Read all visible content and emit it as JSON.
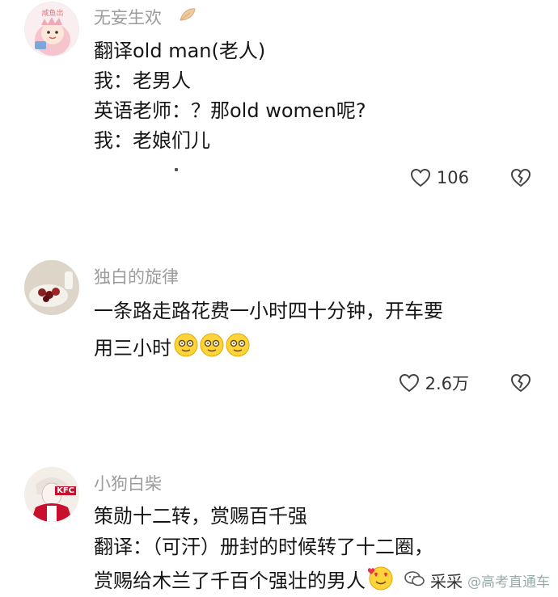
{
  "comments": [
    {
      "username": "无妄生欢",
      "avatar_icon": "pink-dinosaur-hoodie-avatar",
      "avatar_text": "咸鱼出",
      "lines": [
        "翻译old man(老人)",
        "我：老男人",
        "英语老师：？那old women呢?",
        "我：老娘们儿"
      ],
      "likes": "106"
    },
    {
      "username": "独白的旋律",
      "avatar_icon": "fruit-bowl-avatar",
      "lines": [
        "一条路走路花费一小时四十分钟，开车要",
        "用三小时"
      ],
      "likes": "2.6万"
    },
    {
      "username": "小狗白柴",
      "avatar_icon": "kfc-character-avatar",
      "avatar_text": "KFC",
      "lines": [
        "策勋十二转，赏赐百千强",
        "翻译：（可汗）册封的时候转了十二圈，",
        "赏赐给木兰了千百个强壮的男人"
      ]
    }
  ],
  "watermark": {
    "label": "采采",
    "site": "@高考直通车"
  },
  "colors": {
    "username": "#9c9c9c",
    "text": "#161616",
    "pink_accent": "#f3c6cf",
    "kfc_red": "#c8102e"
  }
}
